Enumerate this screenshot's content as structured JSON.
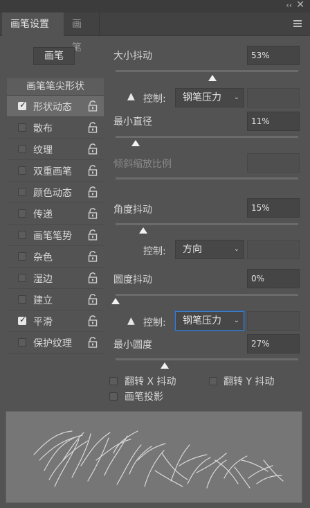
{
  "window": {
    "collapse_glyph": "‹‹",
    "close_glyph": "✕"
  },
  "tabs": [
    {
      "label": "画笔设置"
    },
    {
      "label": "画笔"
    }
  ],
  "brush_button": "画笔",
  "options_header": "画笔笔尖形状",
  "options": [
    {
      "label": "形状动态",
      "checked": true,
      "selected": true
    },
    {
      "label": "散布",
      "checked": false
    },
    {
      "label": "纹理",
      "checked": false
    },
    {
      "label": "双重画笔",
      "checked": false
    },
    {
      "label": "颜色动态",
      "checked": false
    },
    {
      "label": "传递",
      "checked": false
    },
    {
      "label": "画笔笔势",
      "checked": false
    },
    {
      "label": "杂色",
      "checked": false
    },
    {
      "label": "湿边",
      "checked": false
    },
    {
      "label": "建立",
      "checked": false
    },
    {
      "label": "平滑",
      "checked": true
    },
    {
      "label": "保护纹理",
      "checked": false
    }
  ],
  "settings": {
    "size_jitter": {
      "label": "大小抖动",
      "value": "53%",
      "level": 0.53
    },
    "size_control": {
      "warn": "▲",
      "label": "控制:",
      "value": "钢笔压力"
    },
    "min_diameter": {
      "label": "最小直径",
      "value": "11%",
      "level": 0.11
    },
    "tilt_scale": {
      "label": "倾斜缩放比例",
      "value": ""
    },
    "angle_jitter": {
      "label": "角度抖动",
      "value": "15%",
      "level": 0.15
    },
    "angle_control": {
      "label": "控制:",
      "value": "方向"
    },
    "roundness_jitter": {
      "label": "圆度抖动",
      "value": "0%",
      "level": 0.0
    },
    "roundness_control": {
      "warn": "▲",
      "label": "控制:",
      "value": "钢笔压力"
    },
    "min_roundness": {
      "label": "最小圆度",
      "value": "27%",
      "level": 0.27
    }
  },
  "flip_x": "翻转 X 抖动",
  "flip_y": "翻转 Y 抖动",
  "brush_projection": "画笔投影",
  "icons": {
    "lock": "lock-icon",
    "warning": "warning-icon",
    "menu": "menu-icon"
  }
}
